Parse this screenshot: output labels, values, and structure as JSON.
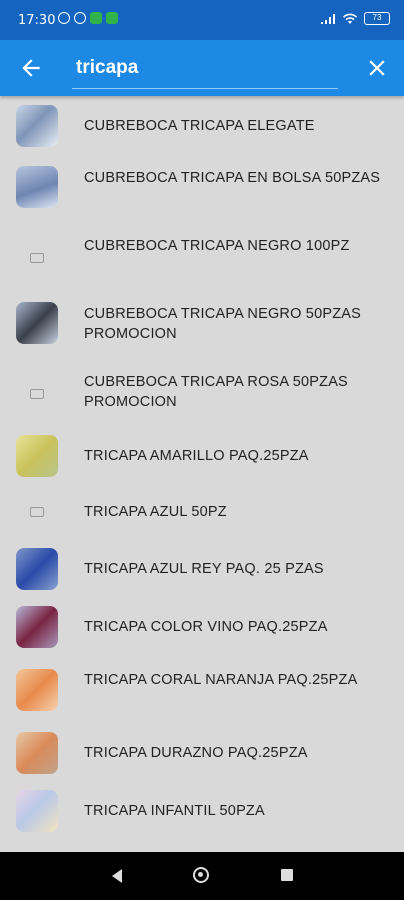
{
  "status_bar": {
    "time": "17:30",
    "battery": "73"
  },
  "search": {
    "value": "tricapa"
  },
  "icons": {
    "back": "arrow-left-icon",
    "clear": "close-icon"
  },
  "results": [
    {
      "label": "CUBREBOCA TRICAPA ELEGATE",
      "thumb": "product-image"
    },
    {
      "label": "CUBREBOCA TRICAPA EN BOLSA 50PZAS",
      "thumb": "product-image"
    },
    {
      "label": "CUBREBOCA TRICAPA NEGRO 100PZ",
      "thumb": "placeholder"
    },
    {
      "label": "CUBREBOCA TRICAPA NEGRO 50PZAS PROMOCION",
      "thumb": "product-image"
    },
    {
      "label": "CUBREBOCA TRICAPA ROSA 50PZAS PROMOCION",
      "thumb": "placeholder"
    },
    {
      "label": "TRICAPA AMARILLO PAQ.25PZA",
      "thumb": "product-image"
    },
    {
      "label": "TRICAPA AZUL 50PZ",
      "thumb": "placeholder"
    },
    {
      "label": "TRICAPA AZUL REY PAQ. 25 PZAS",
      "thumb": "product-image"
    },
    {
      "label": "TRICAPA COLOR VINO PAQ.25PZA",
      "thumb": "product-image"
    },
    {
      "label": "TRICAPA CORAL   NARANJA PAQ.25PZA",
      "thumb": "product-image"
    },
    {
      "label": "TRICAPA DURAZNO PAQ.25PZA",
      "thumb": "product-image"
    },
    {
      "label": "TRICAPA INFANTIL 50PZA",
      "thumb": "product-image"
    }
  ]
}
